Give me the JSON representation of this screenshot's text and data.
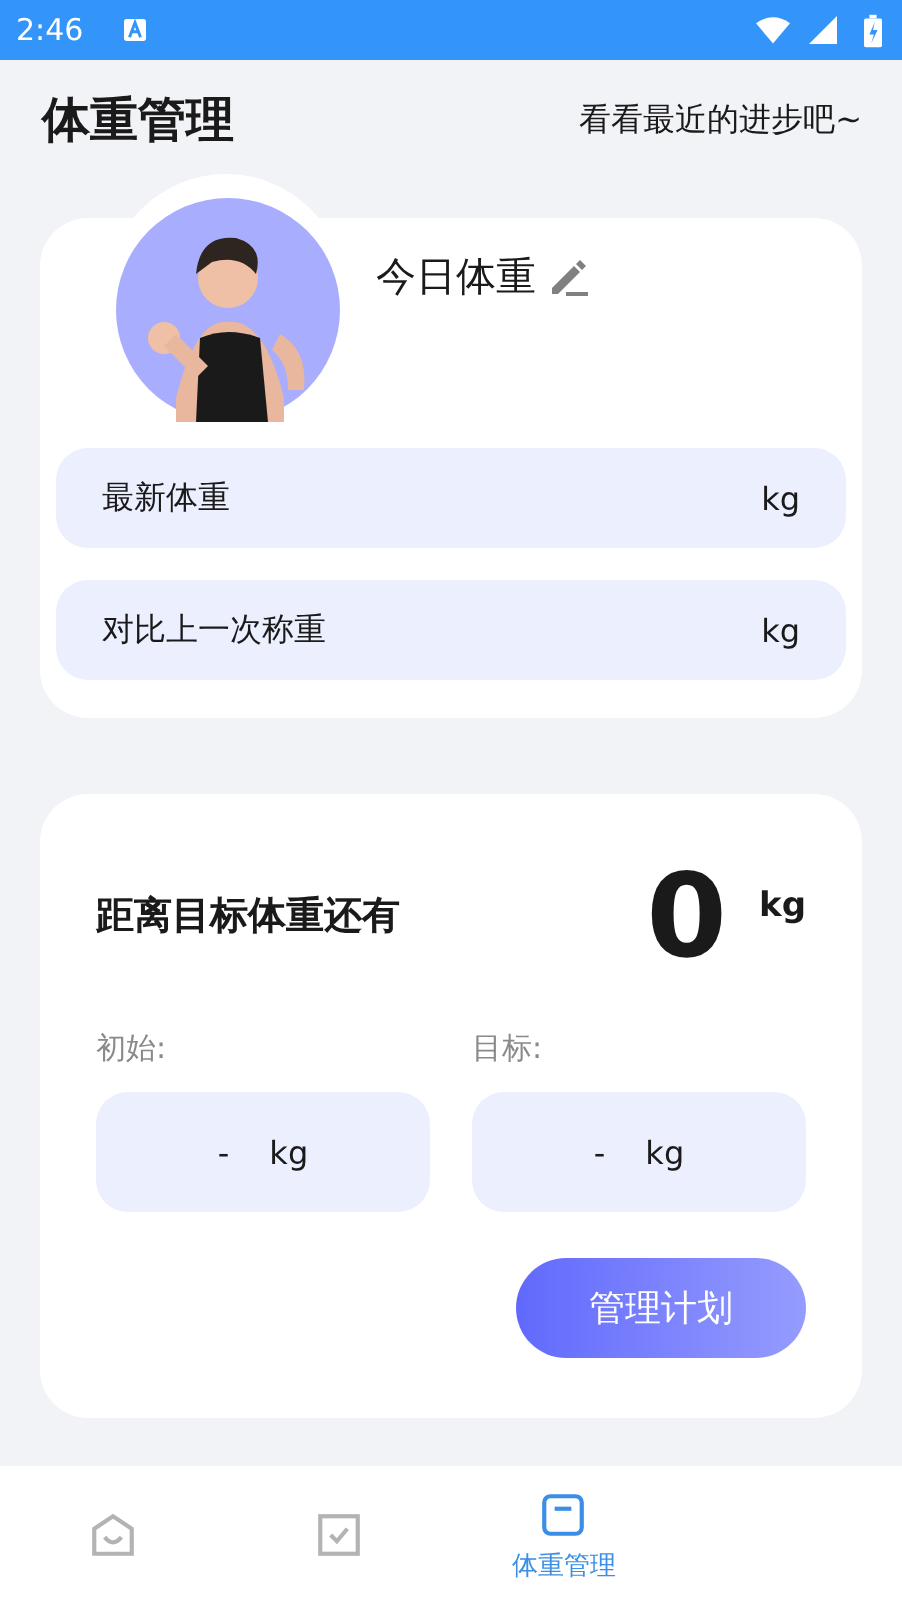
{
  "status_bar": {
    "time": "2:46"
  },
  "header": {
    "title": "体重管理",
    "subtitle": "看看最近的进步吧~"
  },
  "today_card": {
    "title": "今日体重",
    "rows": [
      {
        "label": "最新体重",
        "unit": "kg"
      },
      {
        "label": "对比上一次称重",
        "unit": "kg"
      }
    ]
  },
  "goal_card": {
    "title": "距离目标体重还有",
    "value": "0",
    "unit": "kg",
    "fields": [
      {
        "label": "初始:",
        "value": "-",
        "unit": "kg"
      },
      {
        "label": "目标:",
        "value": "-",
        "unit": "kg"
      }
    ],
    "button": "管理计划"
  },
  "bottom_nav": [
    {
      "kind": "home",
      "selected": false
    },
    {
      "kind": "check",
      "selected": false
    },
    {
      "kind": "weight",
      "label": "体重管理",
      "selected": true
    }
  ]
}
